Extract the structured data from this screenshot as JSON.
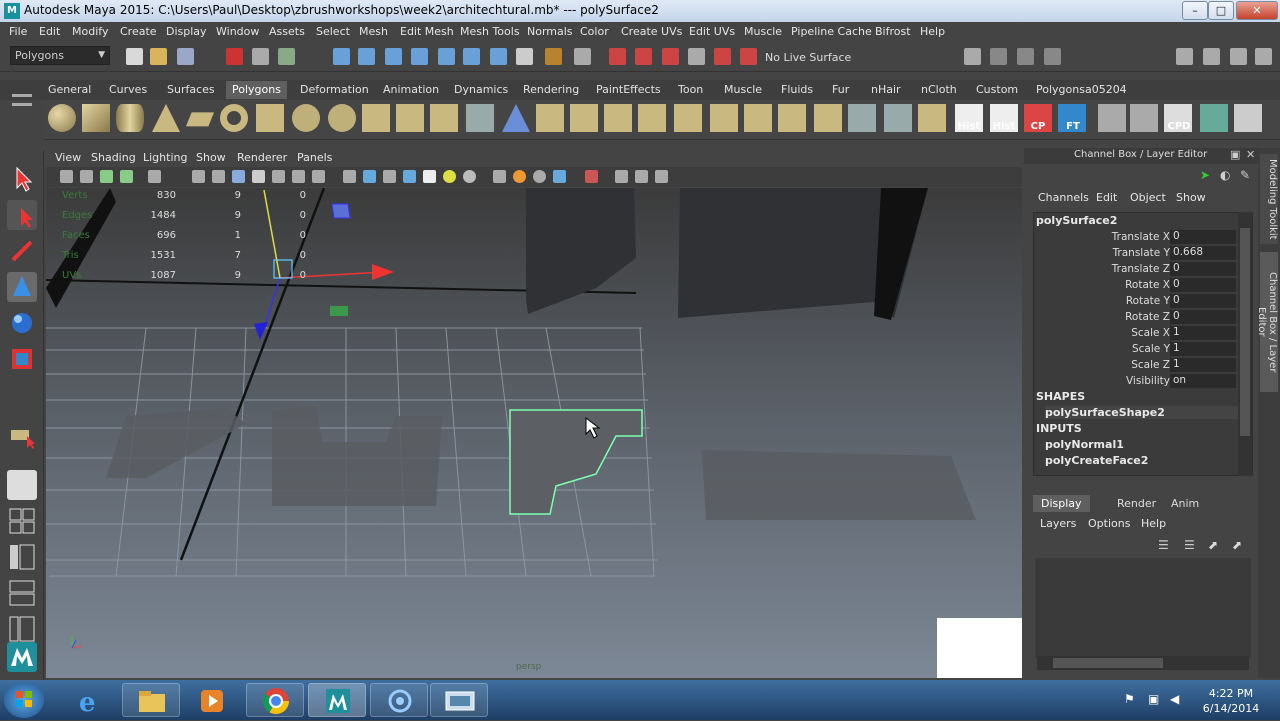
{
  "window": {
    "title": "Autodesk Maya 2015: C:\\Users\\Paul\\Desktop\\zbrushworkshops\\week2\\architechtural.mb*   ---   polySurface2",
    "minimize": "–",
    "maximize": "□",
    "close": "✕"
  },
  "menubar": [
    "File",
    "Edit",
    "Modify",
    "Create",
    "Display",
    "Window",
    "Assets",
    "Select",
    "Mesh",
    "Edit Mesh",
    "Mesh Tools",
    "Normals",
    "Color",
    "Create UVs",
    "Edit UVs",
    "Muscle",
    "Pipeline Cache",
    "Bifrost",
    "Help"
  ],
  "statusline": {
    "mode": "Polygons",
    "live_surface": "No Live Surface"
  },
  "shelf_tabs": [
    "General",
    "Curves",
    "Surfaces",
    "Polygons",
    "Deformation",
    "Animation",
    "Dynamics",
    "Rendering",
    "PaintEffects",
    "Toon",
    "Muscle",
    "Fluids",
    "Fur",
    "nHair",
    "nCloth",
    "Custom",
    "Polygonsa05204"
  ],
  "shelf_active": "Polygons",
  "shelf_text_buttons": [
    "Hist",
    "Hist",
    "CP",
    "FT",
    "CPD"
  ],
  "panel_menu": [
    "View",
    "Shading",
    "Lighting",
    "Show",
    "Renderer",
    "Panels"
  ],
  "hud": {
    "rows": [
      {
        "label": "Verts",
        "a": "830",
        "b": "9",
        "c": "0"
      },
      {
        "label": "Edges",
        "a": "1484",
        "b": "9",
        "c": "0"
      },
      {
        "label": "Faces",
        "a": "696",
        "b": "1",
        "c": "0"
      },
      {
        "label": "Tris",
        "a": "1531",
        "b": "7",
        "c": "0"
      },
      {
        "label": "UVs",
        "a": "1087",
        "b": "9",
        "c": "0"
      }
    ],
    "camera": "persp"
  },
  "channel_box": {
    "header": "Channel Box / Layer Editor",
    "menu": [
      "Channels",
      "Edit",
      "Object",
      "Show"
    ],
    "object": "polySurface2",
    "attributes": [
      {
        "label": "Translate X",
        "value": "0"
      },
      {
        "label": "Translate Y",
        "value": "0.668"
      },
      {
        "label": "Translate Z",
        "value": "0"
      },
      {
        "label": "Rotate X",
        "value": "0"
      },
      {
        "label": "Rotate Y",
        "value": "0"
      },
      {
        "label": "Rotate Z",
        "value": "0"
      },
      {
        "label": "Scale X",
        "value": "1"
      },
      {
        "label": "Scale Y",
        "value": "1"
      },
      {
        "label": "Scale Z",
        "value": "1"
      },
      {
        "label": "Visibility",
        "value": "on"
      }
    ],
    "shapes_header": "SHAPES",
    "shapes": [
      "polySurfaceShape2"
    ],
    "inputs_header": "INPUTS",
    "inputs": [
      "polyNormal1",
      "polyCreateFace2"
    ]
  },
  "layer_editor": {
    "tabs": [
      "Display",
      "Render",
      "Anim"
    ],
    "active_tab": "Display",
    "menu": [
      "Layers",
      "Options",
      "Help"
    ]
  },
  "side_tabs": [
    "Modeling Toolkit",
    "Channel Box / Layer Editor"
  ],
  "taskbar": {
    "time": "4:22 PM",
    "date": "6/14/2014"
  },
  "colors": {
    "selection_outline": "#7dffb0",
    "maya_bg": "#444444",
    "taskbar": "#2a5585"
  }
}
